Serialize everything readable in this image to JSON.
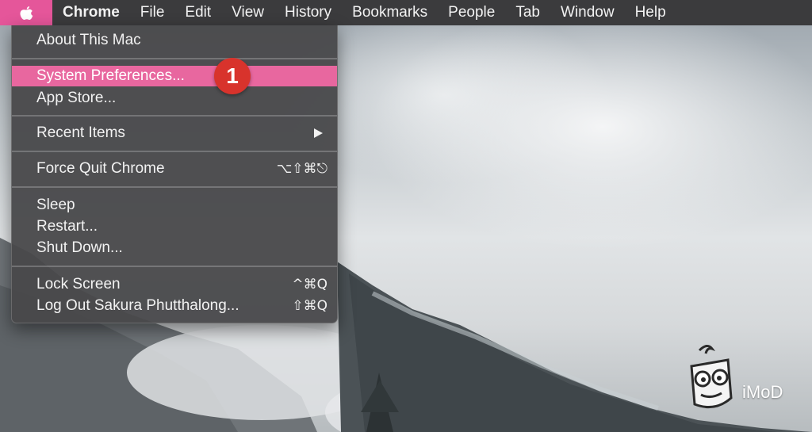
{
  "menubar": {
    "apple_icon": "apple-logo-icon",
    "items": [
      "Chrome",
      "File",
      "Edit",
      "View",
      "History",
      "Bookmarks",
      "People",
      "Tab",
      "Window",
      "Help"
    ]
  },
  "apple_menu": {
    "about": "About This Mac",
    "system_preferences": "System Preferences...",
    "app_store": "App Store...",
    "recent_items": "Recent Items",
    "force_quit": "Force Quit Chrome",
    "force_quit_shortcut": "⌥⇧⌘⎋",
    "sleep": "Sleep",
    "restart": "Restart...",
    "shut_down": "Shut Down...",
    "lock_screen": "Lock Screen",
    "lock_screen_shortcut": "^⌘Q",
    "log_out": "Log Out Sakura Phutthalong...",
    "log_out_shortcut": "⇧⌘Q"
  },
  "step_badge": "1",
  "watermark": {
    "text": "iMoD"
  },
  "colors": {
    "highlight": "#e8679f",
    "menubar": "#3b3b3d",
    "badge": "#d8332c"
  }
}
